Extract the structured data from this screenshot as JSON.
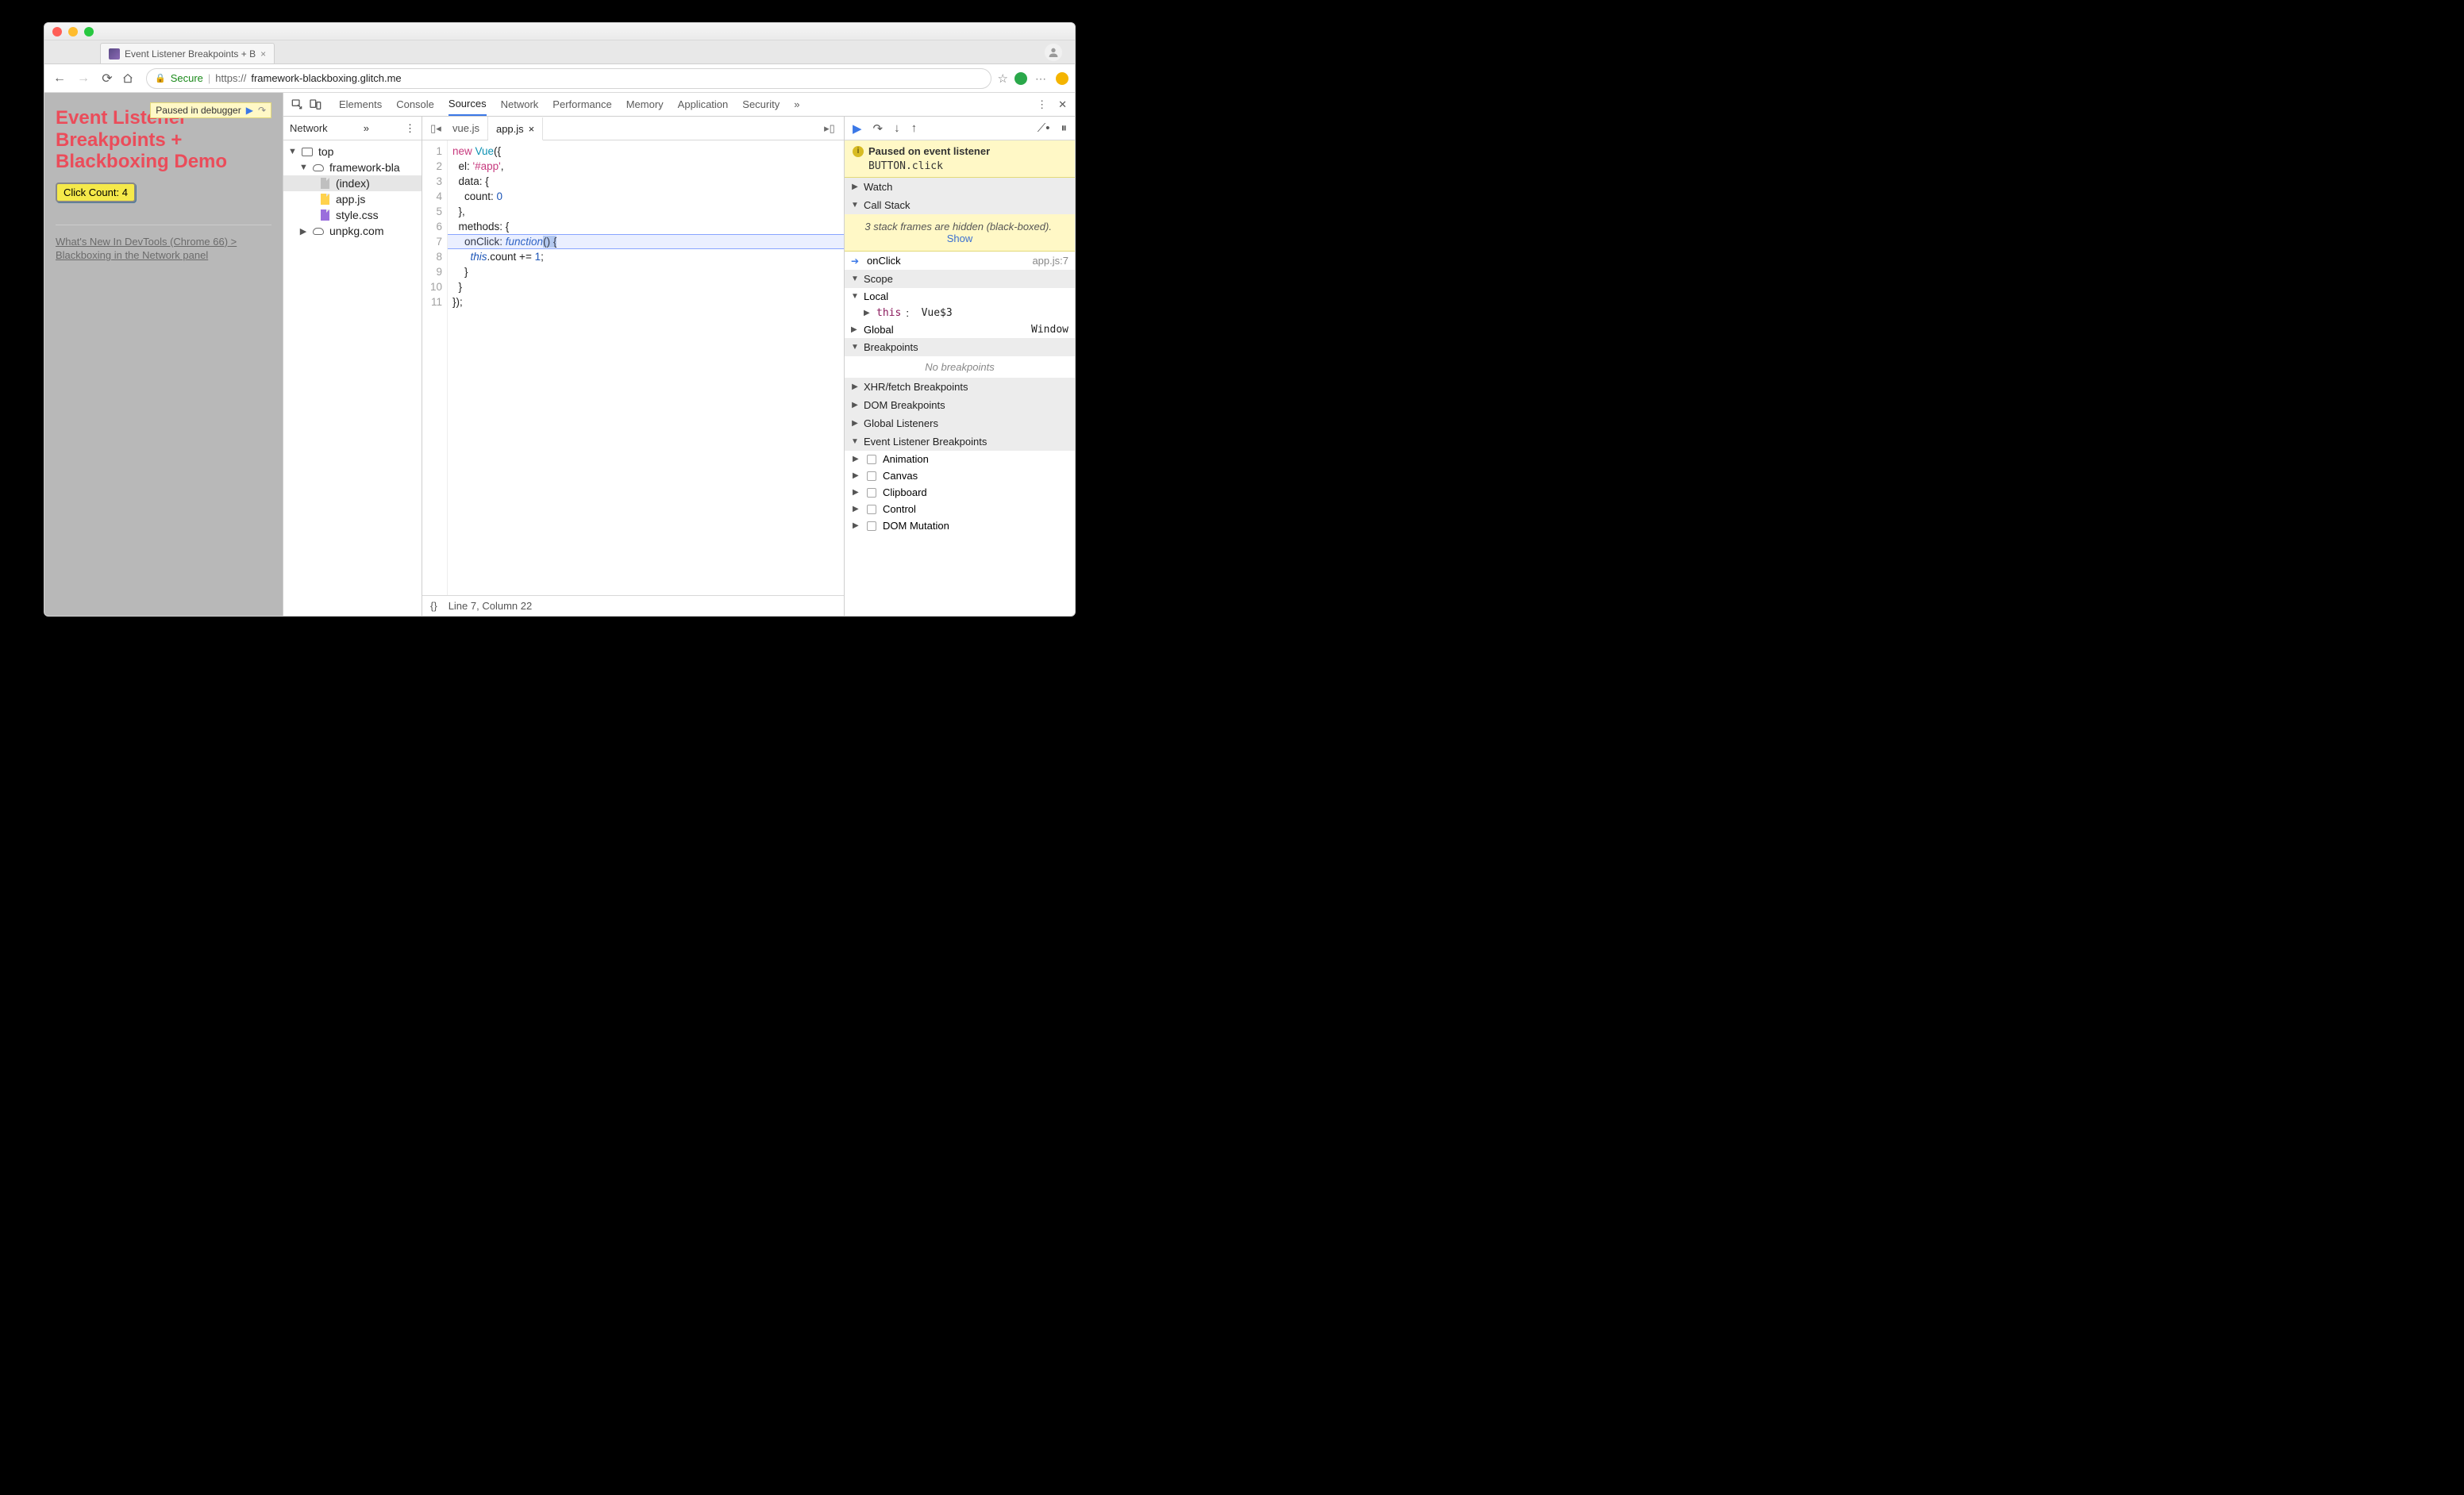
{
  "browser": {
    "tab_title": "Event Listener Breakpoints + B",
    "nav": {
      "back": "←",
      "forward": "→",
      "reload": "⟳",
      "home": "⌂"
    },
    "url_secure": "Secure",
    "url_scheme": "https://",
    "url_host": "framework-blackboxing.glitch.me",
    "star": "☆"
  },
  "page": {
    "paused_overlay": "Paused in debugger",
    "heading": "Event Listener Breakpoints + Blackboxing Demo",
    "click_label": "Click Count: 4",
    "link1": "What's New In DevTools (Chrome 66) > Blackboxing in the Network panel"
  },
  "devtools": {
    "tabs": [
      "Elements",
      "Console",
      "Sources",
      "Network",
      "Performance",
      "Memory",
      "Application",
      "Security"
    ],
    "more": "»",
    "close": "✕"
  },
  "sources_nav": {
    "tab": "Network",
    "more": "»",
    "tree_top": "top",
    "tree_host": "framework-bla",
    "tree_index": "(index)",
    "tree_app": "app.js",
    "tree_css": "style.css",
    "tree_cdn": "unpkg.com"
  },
  "editor": {
    "tabs": [
      {
        "name": "vue.js",
        "active": false,
        "closable": false
      },
      {
        "name": "app.js",
        "active": true,
        "closable": true
      }
    ],
    "status": {
      "braces": "{}",
      "pos": "Line 7, Column 22"
    },
    "line_count": 11,
    "code_lines": {
      "l1_a": "new",
      "l1_b": " Vue",
      "l1_c": "({",
      "l2_a": "  el: ",
      "l2_b": "'#app'",
      "l2_c": ",",
      "l3": "  data: {",
      "l4_a": "    count: ",
      "l4_b": "0",
      "l5": "  },",
      "l6": "  methods: {",
      "l7_a": "    onClick: ",
      "l7_b": "function",
      "l7_c": "()",
      "l7_d": " {",
      "l8_a": "      ",
      "l8_b": "this",
      "l8_c": ".count += ",
      "l8_d": "1",
      "l8_e": ";",
      "l9": "    }",
      "l10": "  }",
      "l11": "});"
    }
  },
  "debugger": {
    "pause_title": "Paused on event listener",
    "pause_detail": "BUTTON.click",
    "sections": {
      "watch": "Watch",
      "call_stack": "Call Stack",
      "scope": "Scope",
      "bp": "Breakpoints",
      "xhr": "XHR/fetch Breakpoints",
      "dom": "DOM Breakpoints",
      "gl": "Global Listeners",
      "elb": "Event Listener Breakpoints"
    },
    "blackbox_note_a": "3 stack frames are hidden (black-boxed).",
    "blackbox_show": "Show",
    "frame_name": "onClick",
    "frame_loc": "app.js:7",
    "scope_local": "Local",
    "scope_this": "this",
    "scope_this_val": "Vue$3",
    "scope_global": "Global",
    "scope_global_val": "Window",
    "bp_empty": "No breakpoints",
    "elb_items": [
      "Animation",
      "Canvas",
      "Clipboard",
      "Control",
      "DOM Mutation"
    ]
  }
}
